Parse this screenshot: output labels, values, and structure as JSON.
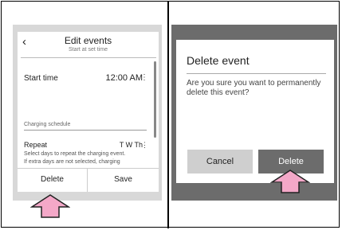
{
  "left_screen": {
    "header": {
      "back_icon": "‹",
      "title": "Edit events",
      "subtitle": "Start at set time"
    },
    "start_time": {
      "label": "Start time",
      "value": "12:00 AM",
      "menu_icon": "⋮"
    },
    "charging_schedule": {
      "label": "Charging schedule"
    },
    "repeat": {
      "label": "Repeat",
      "days": "T W Th",
      "menu_icon": "⋮",
      "description_line1": "Select days to repeat the charging event.",
      "description_line2": "If extra days are not selected, charging"
    },
    "buttons": {
      "delete_label": "Delete",
      "save_label": "Save"
    }
  },
  "right_screen": {
    "dialog": {
      "title": "Delete event",
      "message": "Are you sure you want to permanently delete this event?",
      "cancel_label": "Cancel",
      "delete_label": "Delete"
    }
  },
  "colors": {
    "arrow_fill": "#f4a8c8",
    "dialog_delete_bg": "#6c6c6c",
    "dialog_cancel_bg": "#cfcfcf",
    "overlay": "#6c6c6c"
  },
  "icons": {
    "pointer_arrow": "up-arrow-icon"
  }
}
